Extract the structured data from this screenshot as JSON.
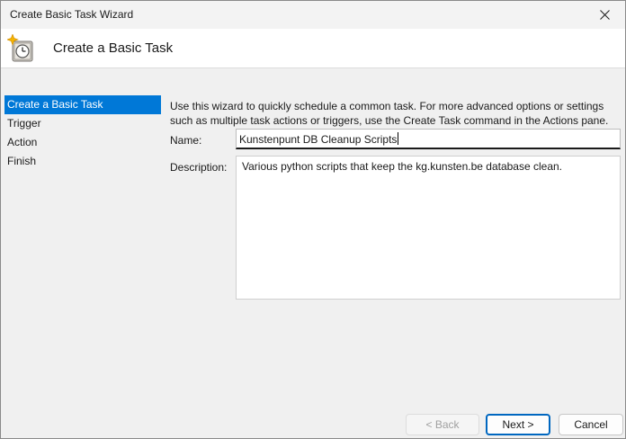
{
  "window": {
    "title": "Create Basic Task Wizard"
  },
  "header": {
    "title": "Create a Basic Task",
    "icon": "task-scheduler-clock-icon"
  },
  "sidebar": {
    "steps": [
      {
        "label": "Create a Basic Task",
        "active": true
      },
      {
        "label": "Trigger",
        "active": false
      },
      {
        "label": "Action",
        "active": false
      },
      {
        "label": "Finish",
        "active": false
      }
    ]
  },
  "main": {
    "intro_line1": "Use this wizard to quickly schedule a common task.  For more advanced options or settings",
    "intro_line2": "such as multiple task actions or triggers, use the Create Task command in the Actions pane.",
    "name_label": "Name:",
    "name_value": "Kunstenpunt DB Cleanup Scripts",
    "description_label": "Description:",
    "description_value": "Various python scripts that keep the kg.kunsten.be database clean."
  },
  "footer": {
    "back_label": "< Back",
    "next_label": "Next >",
    "cancel_label": "Cancel"
  },
  "colors": {
    "accent": "#0078d7",
    "primary_button_border": "#0067c0"
  }
}
